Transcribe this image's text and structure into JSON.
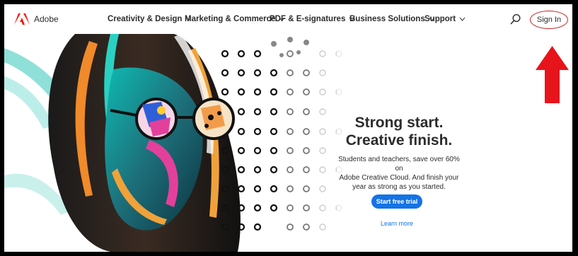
{
  "header": {
    "brand": "Adobe",
    "nav": [
      {
        "label": "Creativity & Design"
      },
      {
        "label": "Marketing & Commerce"
      },
      {
        "label": "PDF & E-signatures"
      },
      {
        "label": "Business Solutions"
      },
      {
        "label": "Support"
      }
    ],
    "sign_in": "Sign In"
  },
  "hero": {
    "headline_line1": "Strong start.",
    "headline_line2": "Creative finish.",
    "subtext_line1": "Students and teachers, save over 60% on",
    "subtext_line2": "Adobe Creative Cloud. And finish your",
    "subtext_line3": "year as strong as you started.",
    "cta": "Start free trial",
    "secondary_link": "Learn more"
  },
  "colors": {
    "brand_red": "#fa0f00",
    "cta_blue": "#1473e6",
    "annotation_red": "#e8141b"
  },
  "icons": [
    "adobe-logo-icon",
    "chevron-down-icon",
    "search-icon",
    "red-arrow-annotation"
  ]
}
